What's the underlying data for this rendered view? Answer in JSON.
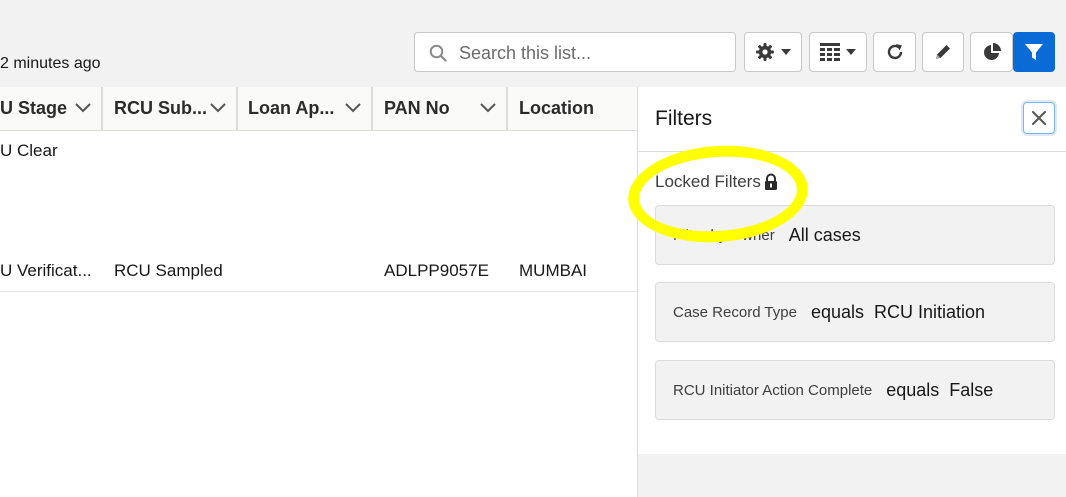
{
  "header": {
    "updated_text": "2 minutes ago",
    "search": {
      "placeholder": "Search this list...",
      "value": ""
    },
    "toolbar": [
      {
        "name": "list-settings-button",
        "icon": "gear-icon",
        "has_menu": true
      },
      {
        "name": "display-as-button",
        "icon": "table-icon",
        "has_menu": true
      },
      {
        "name": "refresh-button",
        "icon": "refresh-icon",
        "has_menu": false
      },
      {
        "name": "edit-list-button",
        "icon": "pencil-icon",
        "has_menu": false
      },
      {
        "name": "charts-button",
        "icon": "pie-chart-icon",
        "has_menu": false
      },
      {
        "name": "filters-button",
        "icon": "filter-icon",
        "has_menu": false,
        "active": true
      }
    ]
  },
  "table": {
    "columns": [
      "U Stage",
      "RCU Sub...",
      "Loan Ap...",
      "PAN No",
      "Location"
    ],
    "rows": [
      [
        "U Clear",
        "",
        "",
        "",
        ""
      ],
      [
        "",
        "",
        "",
        "",
        ""
      ],
      [
        "",
        "",
        "",
        "",
        ""
      ],
      [
        "U Verificat...",
        "RCU Sampled",
        "",
        "ADLPP9057E",
        "MUMBAI"
      ]
    ]
  },
  "filters_panel": {
    "title": "Filters",
    "locked_label": "Locked Filters",
    "filters": [
      {
        "field": "Filter by Owner",
        "operator": "",
        "value": "All cases"
      },
      {
        "field": "Case Record Type",
        "operator": "equals",
        "value": "RCU Initiation"
      },
      {
        "field": "RCU Initiator Action Complete",
        "operator": "equals",
        "value": "False"
      }
    ]
  },
  "colors": {
    "accent": "#0b6bd6",
    "highlight": "#ffff00",
    "panel_bg": "#f3f2f2"
  }
}
